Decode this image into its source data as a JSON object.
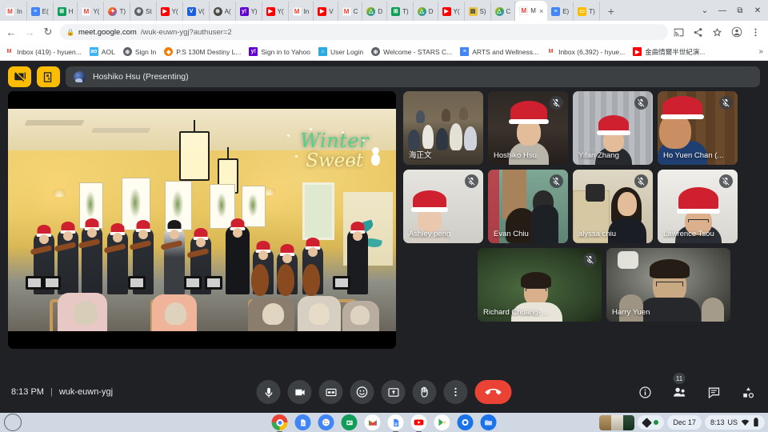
{
  "browser": {
    "tabs": [
      {
        "favicon": "gmail-icon",
        "label": "In"
      },
      {
        "favicon": "slides-icon",
        "label": "E("
      },
      {
        "favicon": "sheets-icon",
        "label": "H"
      },
      {
        "favicon": "gmail-icon",
        "label": "Y("
      },
      {
        "favicon": "photos-icon",
        "label": "T)"
      },
      {
        "favicon": "globe-icon",
        "label": "St"
      },
      {
        "favicon": "youtube-icon",
        "label": "Y("
      },
      {
        "favicon": "vimeo-icon",
        "label": "V("
      },
      {
        "favicon": "globe-icon",
        "label": "A("
      },
      {
        "favicon": "yahoo-icon",
        "label": "Y)"
      },
      {
        "favicon": "youtube-icon",
        "label": "Y("
      },
      {
        "favicon": "gmail-icon",
        "label": "In"
      },
      {
        "favicon": "youtube-icon",
        "label": "V"
      },
      {
        "favicon": "gmail-icon",
        "label": "C"
      },
      {
        "favicon": "drive-icon",
        "label": "D"
      },
      {
        "favicon": "sheets-icon",
        "label": "T)"
      },
      {
        "favicon": "drive-icon",
        "label": "D"
      },
      {
        "favicon": "youtube-icon",
        "label": "Y("
      },
      {
        "favicon": "slides-green-icon",
        "label": "S)"
      },
      {
        "favicon": "drive-icon",
        "label": "C"
      },
      {
        "favicon": "meet-icon",
        "label": "M",
        "active": true,
        "close_label": "×"
      },
      {
        "favicon": "slides-icon",
        "label": "E)"
      },
      {
        "favicon": "folder-icon",
        "label": "T)"
      }
    ],
    "new_tab_label": "+",
    "window_controls": {
      "expand": "⌄",
      "minimize": "—",
      "maximize": "⧉",
      "close": "✕"
    },
    "nav": {
      "back": "←",
      "forward": "→",
      "reload": "↻",
      "lock_icon": "lock-icon",
      "url_host": "meet.google.com",
      "url_path": "/wuk-euwn-ygj?authuser=2",
      "cast_icon": "cast-icon",
      "share_icon": "share-icon",
      "star_icon": "star-icon",
      "profile_icon": "profile-icon",
      "menu_icon": "kebab-menu-icon"
    },
    "bookmarks": [
      {
        "favicon": "gmail-icon",
        "label": "Inbox (419) - hyuen..."
      },
      {
        "favicon": "aol-icon",
        "label": "AOL"
      },
      {
        "favicon": "globe-icon",
        "label": "Sign In"
      },
      {
        "favicon": "destiny-icon",
        "label": "P.S 130M Destiny L..."
      },
      {
        "favicon": "yahoo-icon",
        "label": "Sign in to Yahoo"
      },
      {
        "favicon": "user-icon",
        "label": "User Login"
      },
      {
        "favicon": "globe-icon",
        "label": "Welcome - STARS C..."
      },
      {
        "favicon": "slides-icon",
        "label": "ARTS and Wellness..."
      },
      {
        "favicon": "gmail-icon",
        "label": "Inbox (6,392) - hyue..."
      },
      {
        "favicon": "youtube-icon",
        "label": "金曲情爾半世紀演..."
      }
    ],
    "bookmarks_overflow": "»"
  },
  "meet": {
    "header": {
      "stop_presenting_icon": "present-stop-icon",
      "leave_view_icon": "exit-door-icon",
      "presenter_avatar": "avatar",
      "presenter_label": "Hoshiko Hsu (Presenting)"
    },
    "stage": {
      "overlay_line1": "Winter",
      "overlay_line2": "Sweet",
      "snowman_icon": "snowman-icon"
    },
    "participants": [
      {
        "name": "海正文",
        "muted": false,
        "scene": "class"
      },
      {
        "name": "Hoshiko Hsu",
        "muted": true,
        "scene": "red"
      },
      {
        "name": "Yifan Zhang",
        "muted": true,
        "scene": "gray"
      },
      {
        "name": "Ho Yuen Chan (...",
        "muted": true,
        "scene": "wood"
      },
      {
        "name": "Ashley peng",
        "muted": true,
        "scene": "wall"
      },
      {
        "name": "Evan Chiu",
        "muted": true,
        "scene": "green"
      },
      {
        "name": "alyssa chiu",
        "muted": true,
        "scene": "cream"
      },
      {
        "name": "Lawrence Tsou",
        "muted": true,
        "scene": "white"
      },
      {
        "name": "Richard Chuang-NCALI",
        "muted": true,
        "scene": "darkgreen"
      },
      {
        "name": "Harry Yuen",
        "muted": false,
        "scene": "dim"
      }
    ],
    "footer": {
      "time": "8:13 PM",
      "separator": "|",
      "meeting_code": "wuk-euwn-ygj",
      "controls": [
        {
          "name": "microphone-button",
          "icon": "microphone-icon"
        },
        {
          "name": "camera-button",
          "icon": "video-camera-icon"
        },
        {
          "name": "captions-button",
          "icon": "closed-captions-icon"
        },
        {
          "name": "reactions-button",
          "icon": "smiley-face-icon"
        },
        {
          "name": "present-screen-button",
          "icon": "present-screen-icon"
        },
        {
          "name": "raise-hand-button",
          "icon": "raised-hand-icon"
        },
        {
          "name": "more-options-button",
          "icon": "kebab-menu-icon"
        },
        {
          "name": "leave-call-button",
          "icon": "phone-hangup-icon"
        }
      ],
      "right_controls": [
        {
          "name": "meeting-details-button",
          "icon": "info-icon",
          "badge": ""
        },
        {
          "name": "people-button",
          "icon": "people-icon",
          "badge": "11"
        },
        {
          "name": "chat-button",
          "icon": "chat-bubble-icon",
          "badge": ""
        },
        {
          "name": "activities-button",
          "icon": "activities-icon",
          "badge": ""
        }
      ]
    },
    "colors": {
      "accent_yellow": "#fbbc04",
      "hangup_red": "#ea4335",
      "surface": "#202124",
      "control_surface": "#3c4043"
    }
  },
  "shelf": {
    "launcher_icon": "launcher-circle-icon",
    "apps": [
      {
        "name": "chrome",
        "icon": "chrome-icon",
        "running": true
      },
      {
        "name": "docs-app",
        "icon": "note-icon",
        "running": false
      },
      {
        "name": "canvas",
        "icon": "palette-icon",
        "running": false
      },
      {
        "name": "slides",
        "icon": "slides-icon",
        "running": false
      },
      {
        "name": "gmail",
        "icon": "gmail-icon",
        "running": false
      },
      {
        "name": "docs",
        "icon": "docs-icon",
        "running": true
      },
      {
        "name": "youtube",
        "icon": "youtube-icon",
        "running": true
      },
      {
        "name": "play",
        "icon": "play-store-icon",
        "running": false
      },
      {
        "name": "camera",
        "icon": "camera-icon",
        "running": false
      },
      {
        "name": "files",
        "icon": "folder-icon",
        "running": false
      }
    ],
    "tray": {
      "window_preview_icon": "window-previews-icon",
      "status_icon": "status-diamond-icon",
      "recording_dot": "green-dot-icon",
      "date": "Dec 17",
      "time": "8:13",
      "locale": "US",
      "wifi_icon": "wifi-icon",
      "battery_icon": "battery-icon"
    }
  }
}
